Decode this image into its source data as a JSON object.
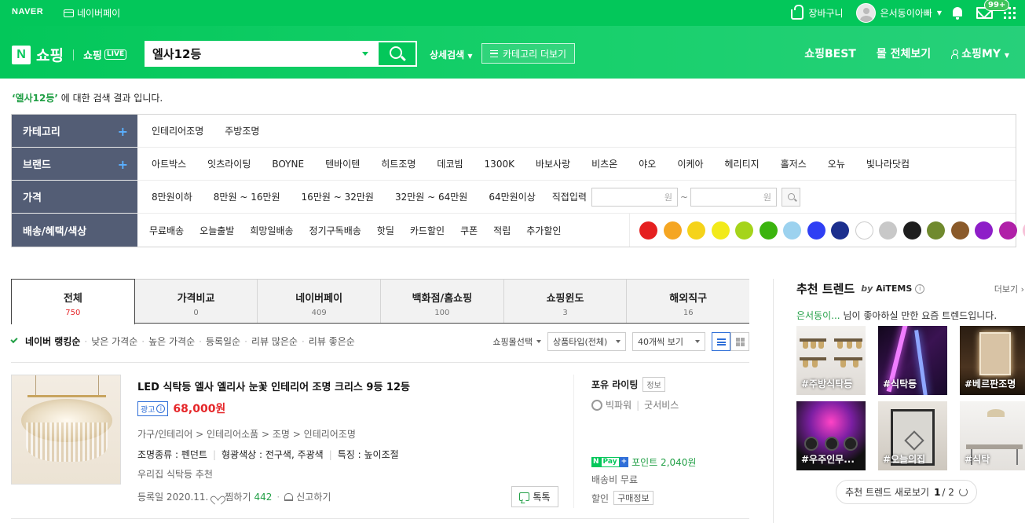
{
  "topbar": {
    "naver": "NAVER",
    "npay": "네이버페이",
    "cart": "장바구니",
    "user": "은서동이아빠",
    "badge": "99+"
  },
  "header": {
    "shopping": "쇼핑",
    "live": "쇼핑",
    "live_tag": "LIVE",
    "search_value": "엘사12등",
    "advanced": "상세검색",
    "category_more": "카테고리 더보기",
    "best": "쇼핑BEST",
    "all_view": "몰 전체보기",
    "my": "쇼핑MY"
  },
  "result": {
    "keyword": "‘엘사12등’",
    "suffix": " 에 대한 검색 결과 입니다."
  },
  "filters": {
    "category_label": "카테고리",
    "categories": [
      "인테리어조명",
      "주방조명"
    ],
    "brand_label": "브랜드",
    "brands": [
      "아트박스",
      "잇츠라이팅",
      "BOYNE",
      "텐바이텐",
      "히트조명",
      "데코빔",
      "1300K",
      "바보사랑",
      "비츠온",
      "야오",
      "이케아",
      "헤리티지",
      "홀저스",
      "오뉴",
      "빛나라닷컴"
    ],
    "price_label": "가격",
    "prices": [
      "8만원이하",
      "8만원 ~ 16만원",
      "16만원 ~ 32만원",
      "32만원 ~ 64만원",
      "64만원이상"
    ],
    "direct_input": "직접입력",
    "won": "원",
    "tilde": "~",
    "benefit_label": "배송/혜택/색상",
    "benefits": [
      "무료배송",
      "오늘출발",
      "희망일배송",
      "정기구독배송",
      "핫딜",
      "카드할인",
      "쿠폰",
      "적립",
      "추가할인"
    ],
    "colors": [
      "#e52020",
      "#f5a623",
      "#f5d31a",
      "#f2ea1a",
      "#a5d41b",
      "#3bb40e",
      "#9cd2ef",
      "#2f3ff4",
      "#1c2f8e",
      "#ffffff",
      "#c8c8c8",
      "#1e1e1e",
      "#708a2e",
      "#8a5a2a",
      "#8e1ec8",
      "#b020a8",
      "#f7c1d8",
      "#8c8c8c"
    ]
  },
  "tabs": [
    {
      "label": "전체",
      "count": "750"
    },
    {
      "label": "가격비교",
      "count": "0"
    },
    {
      "label": "네이버페이",
      "count": "409"
    },
    {
      "label": "백화점/홈쇼핑",
      "count": "100"
    },
    {
      "label": "쇼핑윈도",
      "count": "3"
    },
    {
      "label": "해외직구",
      "count": "16"
    }
  ],
  "sort": {
    "items": [
      "네이버 랭킹순",
      "낮은 가격순",
      "높은 가격순",
      "등록일순",
      "리뷰 많은순",
      "리뷰 좋은순"
    ],
    "mall_select": "쇼핑몰선택",
    "product_type": "상품타입(전체)",
    "per_page": "40개씩 보기"
  },
  "product": {
    "title": "LED 식탁등 엘사 엘리사 눈꽃 인테리어 조명 크리스 9등 12등",
    "ad": "광고",
    "price": "68,000원",
    "category_path": "가구/인테리어 > 인테리어소품 > 조명 > 인테리어조명",
    "attr1": "조명종류 : 펜던트",
    "attr2": "형광색상 : 전구색, 주광색",
    "attr3": "특징 : 높이조절",
    "desc": "우리집 식탁등 추천",
    "date": "등록일 2020.11.",
    "zzim": "찜하기",
    "zzim_count": "442",
    "report": "신고하기",
    "talk": "톡톡",
    "seller": "포유 라이팅",
    "seller_info": "정보",
    "grade": "빅파워",
    "service": "굿서비스",
    "npay_n": "N",
    "npay_pay": "Pay",
    "npay_plus": "+",
    "point": "포인트 2,040원",
    "shipping": "배송비 무료",
    "discount": "할인",
    "buy_info": "구매정보"
  },
  "trend": {
    "title": "추천 트렌드",
    "by": "by",
    "brand": "AiTEMS",
    "info": "i",
    "more": "더보기 ›",
    "user": "은서동이...",
    "sub": " 님이 좋아하실 만한 요즘 트렌드입니다.",
    "tiles": [
      "#주방식탁등",
      "#식탁등",
      "#베르판조명",
      "#우주인무...",
      "#오늘의집",
      "#식탁"
    ],
    "refresh": "추천 트렌드 새로보기",
    "page": "1",
    "total": "/ 2"
  }
}
